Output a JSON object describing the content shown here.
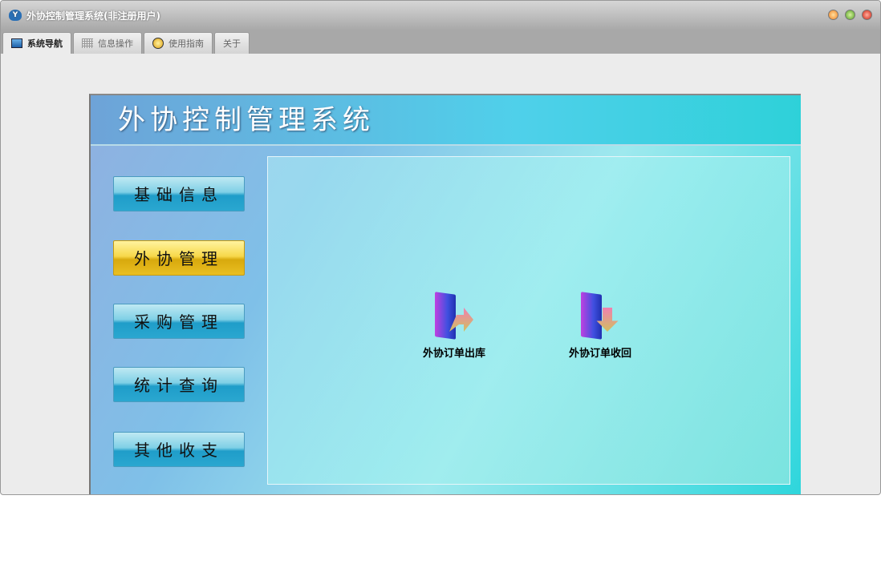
{
  "window": {
    "title": "外协控制管理系统(非注册用户)"
  },
  "tabs": [
    {
      "label": "系统导航"
    },
    {
      "label": "信息操作"
    },
    {
      "label": "使用指南"
    },
    {
      "label": "关于"
    }
  ],
  "header": {
    "title": "外协控制管理系统"
  },
  "menu": [
    {
      "label": "基础信息"
    },
    {
      "label": "外协管理"
    },
    {
      "label": "采购管理"
    },
    {
      "label": "统计查询"
    },
    {
      "label": "其他收支"
    }
  ],
  "actions": [
    {
      "label": "外协订单出库"
    },
    {
      "label": "外协订单收回"
    }
  ]
}
